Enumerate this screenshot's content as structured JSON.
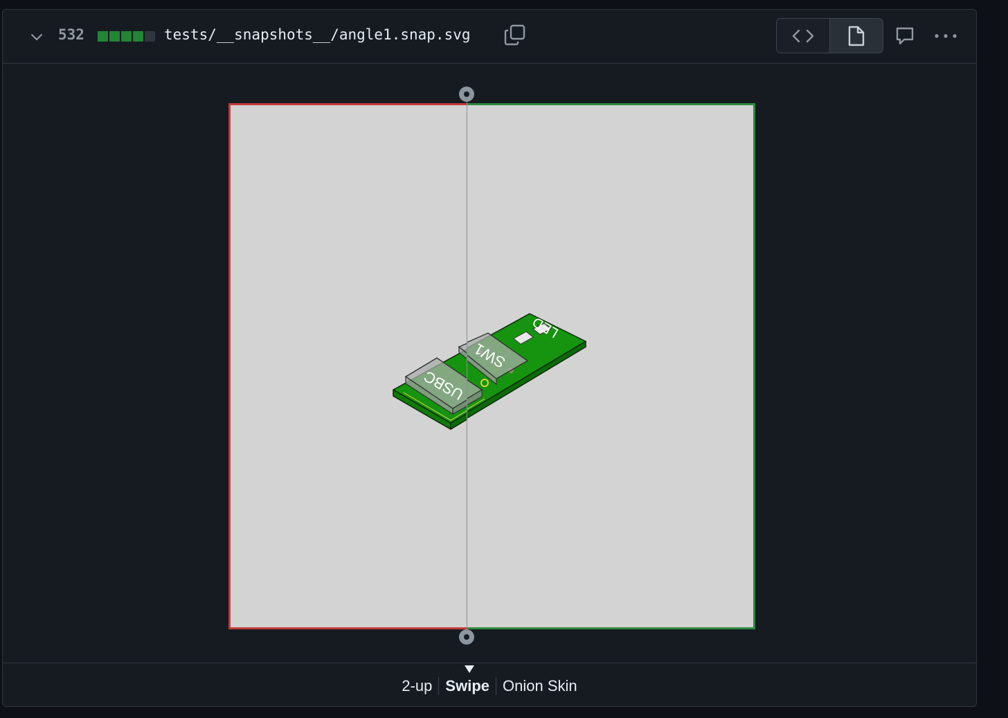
{
  "header": {
    "changed_lines": "532",
    "diffstat": [
      "#238636",
      "#238636",
      "#238636",
      "#238636",
      "#30363d"
    ],
    "filename": "tests/__snapshots__/angle1.snap.svg",
    "icons": {
      "collapse": "chevron-down-icon",
      "copy": "copy-icon",
      "code_view": "code-icon",
      "rich_view": "file-icon",
      "comment": "comment-icon",
      "more": "kebab-horizontal-icon"
    }
  },
  "image": {
    "background": "#d3d3d3",
    "board_color": "#16930f",
    "labels": {
      "usb": "USBC",
      "switch": "SW1",
      "led": "LED"
    },
    "deleted_border": "#c33a3a",
    "added_border": "#2d8a3e"
  },
  "modes": {
    "two_up": "2-up",
    "swipe": "Swipe",
    "onion_skin": "Onion Skin",
    "selected": "Swipe"
  }
}
